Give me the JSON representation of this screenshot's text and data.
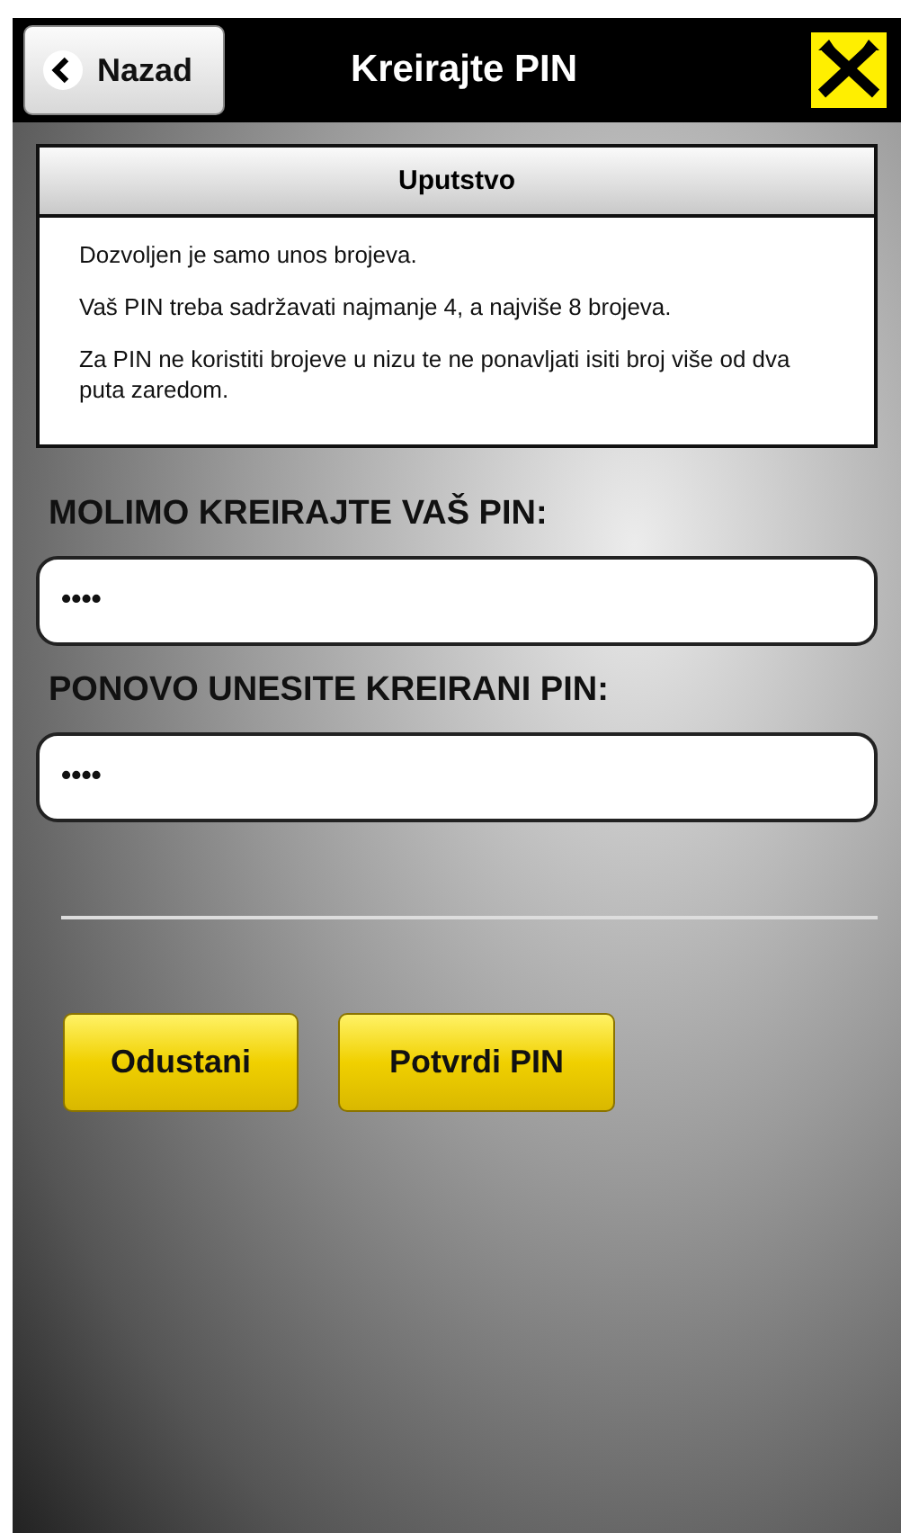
{
  "header": {
    "back_button": "Nazad",
    "title": "Kreirajte PIN"
  },
  "instructions": {
    "title": "Uputstvo",
    "paragraphs": [
      "Dozvoljen je samo unos brojeva.",
      "Vaš PIN treba sadržavati najmanje 4, a najviše 8 brojeva.",
      "Za PIN ne koristiti brojeve u nizu te ne ponavljati isiti broj više od dva puta zaredom."
    ]
  },
  "fields": [
    {
      "label": "MOLIMO KREIRAJTE VAŠ PIN:",
      "value": "••••"
    },
    {
      "label": "PONOVO UNESITE KREIRANI PIN:",
      "value": "••••"
    }
  ],
  "buttons": [
    "Odustani",
    "Potvrdi PIN"
  ]
}
